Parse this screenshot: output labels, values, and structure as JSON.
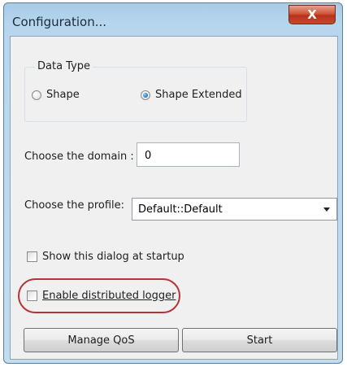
{
  "window": {
    "title": "Configuration...",
    "close_glyph": "X"
  },
  "data_type": {
    "label": "Data Type",
    "options": [
      {
        "label": "Shape",
        "checked": false
      },
      {
        "label": "Shape Extended",
        "checked": true
      }
    ]
  },
  "domain": {
    "label": "Choose the domain :",
    "value": "0"
  },
  "profile": {
    "label": "Choose the profile:",
    "selected": "Default::Default"
  },
  "options": {
    "show_dialog": {
      "label": "Show this dialog at startup",
      "checked": false
    },
    "distributed_logger": {
      "label": "Enable distributed logger",
      "checked": false
    }
  },
  "buttons": {
    "manage_qos": "Manage QoS",
    "start": "Start"
  },
  "colors": {
    "close_button": "#c9482c",
    "highlight": "#b53434",
    "title_bar": "#b7d6ee"
  }
}
